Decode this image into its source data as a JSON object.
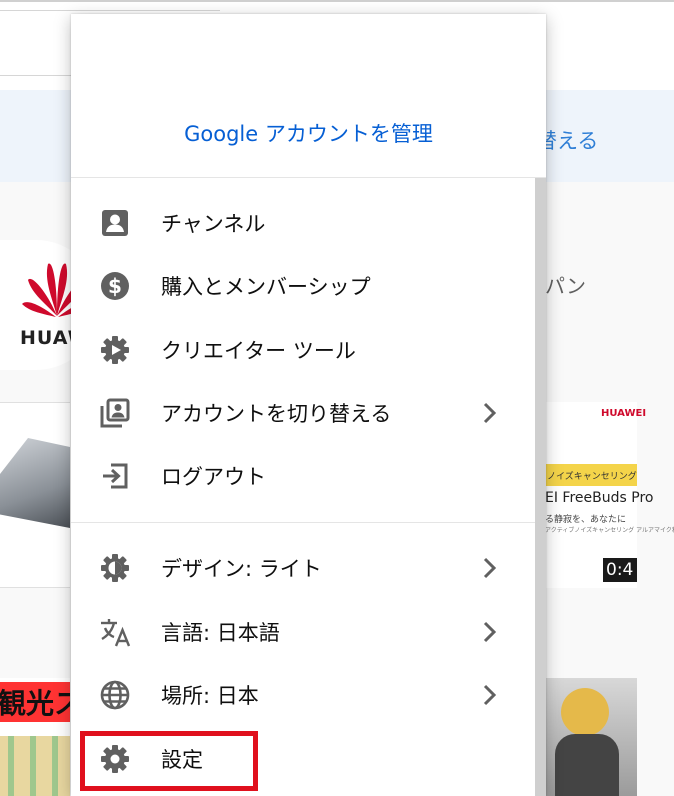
{
  "background": {
    "banner_text": "り替える",
    "ad_text": "パン",
    "logo_text": "HUAWEI",
    "right_thumb": {
      "logo": "HUAWEI",
      "band": "ノイズキャンセリング搭載",
      "product": "EI FreeBuds Pro",
      "subtitle": "る静寂を、あなたに",
      "fine_print": "アクティブノイズキャンセリング アルアマイク利用搭載"
    },
    "duration": "0:4",
    "bottom_left_text": "観光ス"
  },
  "menu": {
    "manage_account": "Google アカウントを管理",
    "items": [
      {
        "icon": "account-box-icon",
        "label": "チャンネル",
        "has_submenu": false
      },
      {
        "icon": "dollar-circle-icon",
        "label": "購入とメンバーシップ",
        "has_submenu": false
      },
      {
        "icon": "creator-studio-gear-icon",
        "label": "クリエイター ツール",
        "has_submenu": false
      },
      {
        "icon": "switch-account-icon",
        "label": "アカウントを切り替える",
        "has_submenu": true
      },
      {
        "icon": "sign-out-icon",
        "label": "ログアウト",
        "has_submenu": false
      },
      {
        "icon": "theme-icon",
        "label": "デザイン: ライト",
        "has_submenu": true
      },
      {
        "icon": "translate-icon",
        "label": "言語: 日本語",
        "has_submenu": true
      },
      {
        "icon": "globe-icon",
        "label": "場所: 日本",
        "has_submenu": true
      },
      {
        "icon": "settings-gear-icon",
        "label": "設定",
        "has_submenu": false
      }
    ]
  },
  "colors": {
    "link_blue": "#065fd4",
    "icon_gray": "#606060",
    "highlight_red": "#e0101d",
    "huawei_red": "#cf0a2c"
  }
}
